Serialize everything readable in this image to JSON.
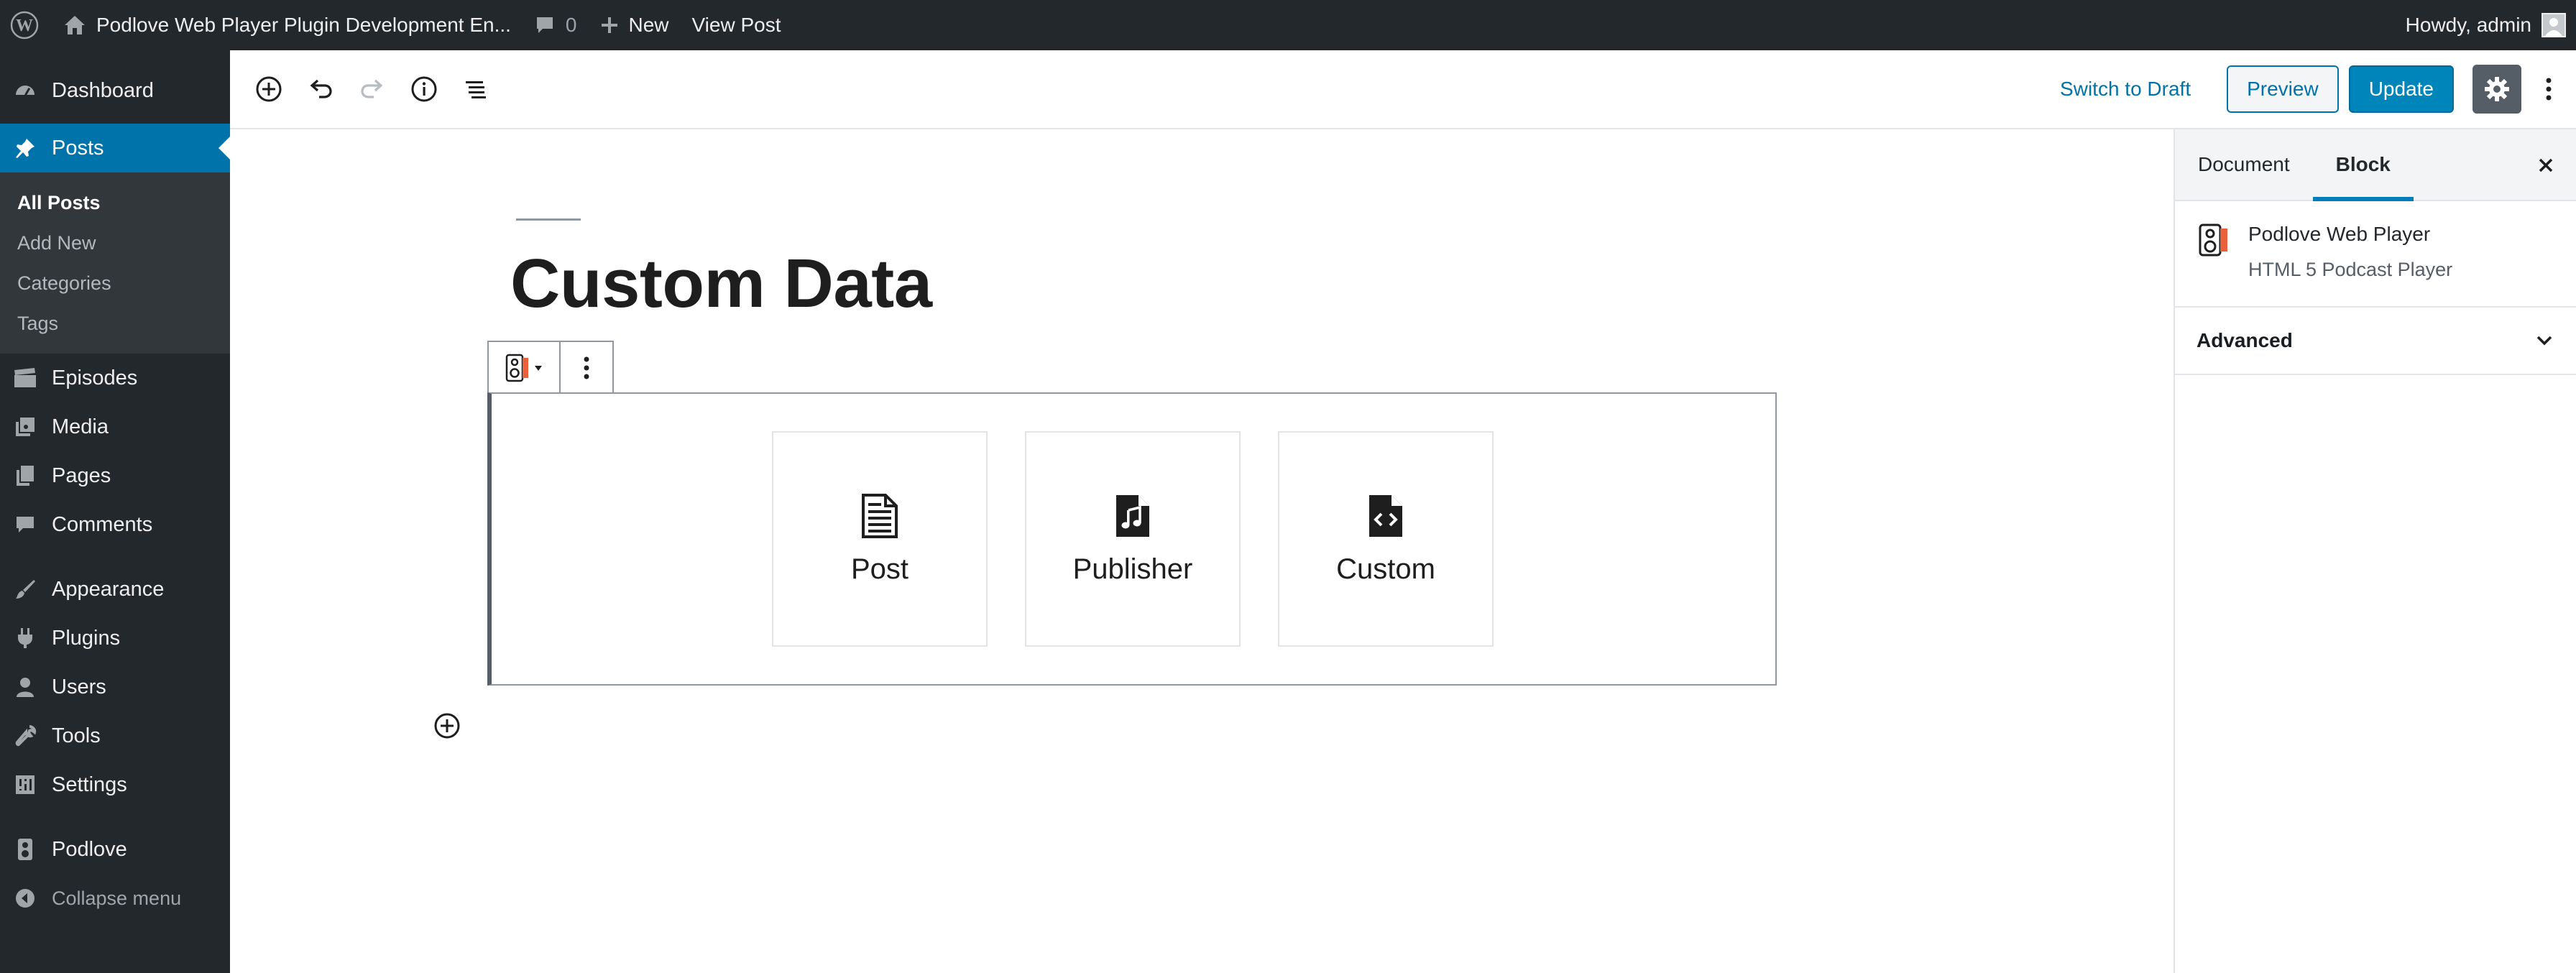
{
  "admin_bar": {
    "site_name": "Podlove Web Player Plugin Development En...",
    "comment_count": "0",
    "new_label": "New",
    "view_post_label": "View Post",
    "howdy": "Howdy, admin"
  },
  "sidebar": {
    "dashboard": "Dashboard",
    "posts": "Posts",
    "submenu": {
      "all_posts": "All Posts",
      "add_new": "Add New",
      "categories": "Categories",
      "tags": "Tags"
    },
    "episodes": "Episodes",
    "media": "Media",
    "pages": "Pages",
    "comments": "Comments",
    "appearance": "Appearance",
    "plugins": "Plugins",
    "users": "Users",
    "tools": "Tools",
    "settings": "Settings",
    "podlove": "Podlove",
    "collapse": "Collapse menu"
  },
  "editor_header": {
    "switch_to_draft": "Switch to Draft",
    "preview": "Preview",
    "update": "Update"
  },
  "post": {
    "title": "Custom Data"
  },
  "block": {
    "choices": [
      {
        "label": "Post",
        "icon": "document-icon"
      },
      {
        "label": "Publisher",
        "icon": "music-file-icon"
      },
      {
        "label": "Custom",
        "icon": "code-file-icon"
      }
    ]
  },
  "settings_sidebar": {
    "tabs": {
      "document": "Document",
      "block": "Block"
    },
    "block_card": {
      "title": "Podlove Web Player",
      "description": "HTML 5 Podcast Player"
    },
    "advanced": "Advanced"
  },
  "colors": {
    "admin_bg": "#23282d",
    "active_menu": "#0073aa",
    "primary_button": "#0085ba",
    "podlove_accent": "#e8613c"
  }
}
